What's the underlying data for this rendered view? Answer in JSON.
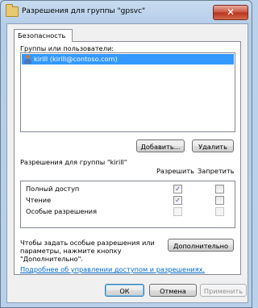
{
  "window": {
    "title": "Разрешения для группы \"gpsvc\"",
    "close_glyph": "✕"
  },
  "tabs": [
    {
      "label": "Безопасность",
      "active": true
    }
  ],
  "groups_section": {
    "label": "Группы или пользователи:",
    "items": [
      {
        "name": "kirill (kirill@contoso.com)",
        "icon": "user-icon",
        "selected": true
      }
    ],
    "add_label": "Добавить...",
    "remove_label": "Удалить"
  },
  "permissions": {
    "header": "Разрешения для группы \"kirill\"",
    "allow_label": "Разрешить",
    "deny_label": "Запретить",
    "rows": [
      {
        "name": "Полный доступ",
        "allow": true,
        "deny": false,
        "enabled": true
      },
      {
        "name": "Чтение",
        "allow": true,
        "deny": false,
        "enabled": true
      },
      {
        "name": "Особые разрешения",
        "allow": false,
        "deny": false,
        "enabled": false
      }
    ]
  },
  "special": {
    "text_line1": "Чтобы задать особые разрешения или",
    "text_line2": "параметры, нажмите кнопку",
    "text_line3": "\"Дополнительно\".",
    "advanced_label": "Дополнительно"
  },
  "learn_more_link": "Подробнее об управлении доступом и разрешениях.",
  "footer": {
    "ok_label": "ОК",
    "cancel_label": "Отмена",
    "apply_label": "Применить"
  },
  "colors": {
    "selection": "#3399ff",
    "link": "#0066cc",
    "close_button": "#c7533f"
  }
}
